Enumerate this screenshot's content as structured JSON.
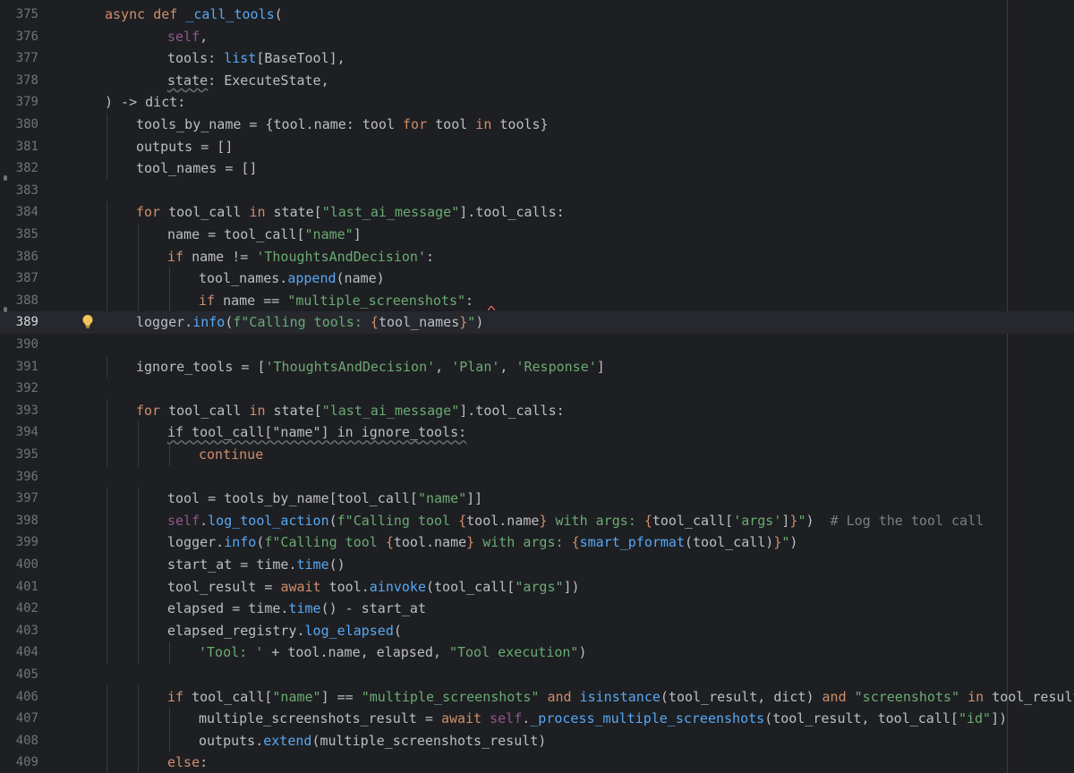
{
  "editor": {
    "current_line": 389,
    "lines": [
      {
        "n": 375,
        "indent": 0,
        "tokens": [
          [
            "async ",
            "kw"
          ],
          [
            "def ",
            "kw"
          ],
          [
            "_call_tools",
            "fn"
          ],
          [
            "(",
            ""
          ]
        ]
      },
      {
        "n": 376,
        "indent": 2,
        "tokens": [
          [
            "self",
            "self"
          ],
          [
            ",",
            ""
          ]
        ]
      },
      {
        "n": 377,
        "indent": 2,
        "tokens": [
          [
            "tools",
            ""
          ],
          [
            ": ",
            ""
          ],
          [
            "list",
            "m"
          ],
          [
            "[BaseTool],",
            ""
          ]
        ]
      },
      {
        "n": 378,
        "indent": 2,
        "tokens": [
          [
            "state",
            "sq"
          ],
          [
            ": ExecuteState,",
            ""
          ]
        ]
      },
      {
        "n": 379,
        "indent": 0,
        "tokens": [
          [
            ") -> ",
            ""
          ],
          [
            "dict",
            ""
          ],
          [
            ":",
            ""
          ]
        ]
      },
      {
        "n": 380,
        "indent": 1,
        "tokens": [
          [
            "tools_by_name = {tool.name: tool ",
            ""
          ],
          [
            "for ",
            "kw"
          ],
          [
            "tool ",
            ""
          ],
          [
            "in ",
            "kw"
          ],
          [
            "tools",
            ""
          ],
          [
            "}",
            ""
          ]
        ]
      },
      {
        "n": 381,
        "indent": 1,
        "tokens": [
          [
            "outputs = []",
            ""
          ]
        ]
      },
      {
        "n": 382,
        "indent": 1,
        "tokens": [
          [
            "tool_names = []",
            ""
          ]
        ]
      },
      {
        "n": 383,
        "indent": 0,
        "tokens": []
      },
      {
        "n": 384,
        "indent": 1,
        "tokens": [
          [
            "for ",
            "kw"
          ],
          [
            "tool_call ",
            ""
          ],
          [
            "in ",
            "kw"
          ],
          [
            "state[",
            ""
          ],
          [
            "\"last_ai_message\"",
            "str"
          ],
          [
            "].tool_calls:",
            ""
          ]
        ]
      },
      {
        "n": 385,
        "indent": 2,
        "tokens": [
          [
            "name = tool_call[",
            ""
          ],
          [
            "\"name\"",
            "str"
          ],
          [
            "]",
            ""
          ]
        ]
      },
      {
        "n": 386,
        "indent": 2,
        "tokens": [
          [
            "if ",
            "kw"
          ],
          [
            "name != ",
            ""
          ],
          [
            "'ThoughtsAndDecision'",
            "str"
          ],
          [
            ":",
            ""
          ]
        ]
      },
      {
        "n": 387,
        "indent": 3,
        "tokens": [
          [
            "tool_names.",
            ""
          ],
          [
            "append",
            "m"
          ],
          [
            "(name)",
            ""
          ]
        ]
      },
      {
        "n": 388,
        "indent": 3,
        "tokens": [
          [
            "if ",
            "kw"
          ],
          [
            "name == ",
            ""
          ],
          [
            "\"multiple_screenshots\"",
            "str"
          ],
          [
            ":",
            ""
          ]
        ]
      },
      {
        "n": 389,
        "indent": 1,
        "tokens": [
          [
            "logger.",
            ""
          ],
          [
            "info",
            "m"
          ],
          [
            "(",
            ""
          ],
          [
            "f\"Calling tools: ",
            "str"
          ],
          [
            "{",
            "br"
          ],
          [
            "tool_names",
            ""
          ],
          [
            "}",
            "br"
          ],
          [
            "\"",
            "str"
          ],
          [
            ")",
            ""
          ]
        ]
      },
      {
        "n": 390,
        "indent": 0,
        "tokens": []
      },
      {
        "n": 391,
        "indent": 1,
        "tokens": [
          [
            "ignore_tools = [",
            ""
          ],
          [
            "'ThoughtsAndDecision'",
            "str"
          ],
          [
            ", ",
            ""
          ],
          [
            "'Plan'",
            "str"
          ],
          [
            ", ",
            ""
          ],
          [
            "'Response'",
            "str"
          ],
          [
            "]",
            ""
          ]
        ]
      },
      {
        "n": 392,
        "indent": 0,
        "tokens": []
      },
      {
        "n": 393,
        "indent": 1,
        "tokens": [
          [
            "for ",
            "kw"
          ],
          [
            "tool_call ",
            ""
          ],
          [
            "in ",
            "kw"
          ],
          [
            "state[",
            ""
          ],
          [
            "\"last_ai_message\"",
            "str"
          ],
          [
            "].tool_calls:",
            ""
          ]
        ]
      },
      {
        "n": 394,
        "indent": 2,
        "tokens": [
          [
            "if tool_call[\"name\"] in ignore_tools:",
            "sq"
          ]
        ]
      },
      {
        "n": 395,
        "indent": 3,
        "tokens": [
          [
            "continue",
            "kw"
          ]
        ]
      },
      {
        "n": 396,
        "indent": 0,
        "tokens": []
      },
      {
        "n": 397,
        "indent": 2,
        "tokens": [
          [
            "tool = tools_by_name[tool_call[",
            ""
          ],
          [
            "\"name\"",
            "str"
          ],
          [
            "]]",
            ""
          ]
        ]
      },
      {
        "n": 398,
        "indent": 2,
        "tokens": [
          [
            "self",
            "self"
          ],
          [
            ".",
            ""
          ],
          [
            "log_tool_action",
            "m"
          ],
          [
            "(",
            ""
          ],
          [
            "f\"Calling tool ",
            "str"
          ],
          [
            "{",
            "br"
          ],
          [
            "tool.name",
            ""
          ],
          [
            "}",
            "br"
          ],
          [
            " with args: ",
            "str"
          ],
          [
            "{",
            "br"
          ],
          [
            "tool_call[",
            ""
          ],
          [
            "'args'",
            "str"
          ],
          [
            "]",
            ""
          ],
          [
            "}",
            "br"
          ],
          [
            "\"",
            "str"
          ],
          [
            ")  ",
            ""
          ],
          [
            "# Log the tool call",
            "cm"
          ]
        ]
      },
      {
        "n": 399,
        "indent": 2,
        "tokens": [
          [
            "logger.",
            ""
          ],
          [
            "info",
            "m"
          ],
          [
            "(",
            ""
          ],
          [
            "f\"Calling tool ",
            "str"
          ],
          [
            "{",
            "br"
          ],
          [
            "tool.name",
            ""
          ],
          [
            "}",
            "br"
          ],
          [
            " with args: ",
            "str"
          ],
          [
            "{",
            "br"
          ],
          [
            "smart_pformat",
            "m"
          ],
          [
            "(tool_call)",
            ""
          ],
          [
            "}",
            "br"
          ],
          [
            "\"",
            "str"
          ],
          [
            ")",
            ""
          ]
        ]
      },
      {
        "n": 400,
        "indent": 2,
        "tokens": [
          [
            "start_at = time.",
            ""
          ],
          [
            "time",
            "m"
          ],
          [
            "()",
            ""
          ]
        ]
      },
      {
        "n": 401,
        "indent": 2,
        "tokens": [
          [
            "tool_result = ",
            ""
          ],
          [
            "await ",
            "kw"
          ],
          [
            "tool.",
            ""
          ],
          [
            "ainvoke",
            "m"
          ],
          [
            "(tool_call[",
            ""
          ],
          [
            "\"args\"",
            "str"
          ],
          [
            "])",
            ""
          ]
        ]
      },
      {
        "n": 402,
        "indent": 2,
        "tokens": [
          [
            "elapsed = time.",
            ""
          ],
          [
            "time",
            "m"
          ],
          [
            "() - start_at",
            ""
          ]
        ]
      },
      {
        "n": 403,
        "indent": 2,
        "tokens": [
          [
            "elapsed_registry.",
            ""
          ],
          [
            "log_elapsed",
            "m"
          ],
          [
            "(",
            ""
          ]
        ]
      },
      {
        "n": 404,
        "indent": 3,
        "tokens": [
          [
            "'Tool: '",
            "str"
          ],
          [
            " + tool.name, elapsed, ",
            ""
          ],
          [
            "\"Tool execution\"",
            "str"
          ],
          [
            ")",
            ""
          ]
        ]
      },
      {
        "n": 405,
        "indent": 0,
        "tokens": []
      },
      {
        "n": 406,
        "indent": 2,
        "tokens": [
          [
            "if ",
            "kw"
          ],
          [
            "tool_call[",
            ""
          ],
          [
            "\"name\"",
            "str"
          ],
          [
            "] == ",
            ""
          ],
          [
            "\"multiple_screenshots\"",
            "str"
          ],
          [
            " ",
            ""
          ],
          [
            "and ",
            "kw"
          ],
          [
            "isinstance",
            "m"
          ],
          [
            "(tool_result, ",
            ""
          ],
          [
            "dict",
            ""
          ],
          [
            ") ",
            ""
          ],
          [
            "and ",
            "kw"
          ],
          [
            "\"screenshots\"",
            "str"
          ],
          [
            " ",
            ""
          ],
          [
            "in ",
            "kw"
          ],
          [
            "tool_result:",
            ""
          ]
        ]
      },
      {
        "n": 407,
        "indent": 3,
        "tokens": [
          [
            "multiple_screenshots_result = ",
            ""
          ],
          [
            "await ",
            "kw"
          ],
          [
            "self",
            "self"
          ],
          [
            ".",
            ""
          ],
          [
            "_process_multiple_screenshots",
            "m"
          ],
          [
            "(tool_result, tool_call[",
            ""
          ],
          [
            "\"id\"",
            "str"
          ],
          [
            "])",
            ""
          ]
        ]
      },
      {
        "n": 408,
        "indent": 3,
        "tokens": [
          [
            "outputs.",
            ""
          ],
          [
            "extend",
            "m"
          ],
          [
            "(multiple_screenshots_result)",
            ""
          ]
        ]
      },
      {
        "n": 409,
        "indent": 2,
        "tokens": [
          [
            "else",
            "kw"
          ],
          [
            ":",
            ""
          ]
        ]
      }
    ],
    "guides": {
      "380": [
        1
      ],
      "381": [
        1
      ],
      "382": [
        1
      ],
      "384": [
        1
      ],
      "385": [
        1,
        2
      ],
      "386": [
        1,
        2
      ],
      "387": [
        1,
        2,
        3
      ],
      "388": [
        1,
        2,
        3
      ],
      "391": [
        1
      ],
      "393": [
        1
      ],
      "394": [
        1,
        2
      ],
      "395": [
        1,
        2,
        3
      ],
      "397": [
        1,
        2
      ],
      "398": [
        1,
        2
      ],
      "399": [
        1,
        2
      ],
      "400": [
        1,
        2
      ],
      "401": [
        1,
        2
      ],
      "402": [
        1,
        2
      ],
      "403": [
        1,
        2
      ],
      "404": [
        1,
        2,
        3
      ],
      "406": [
        1,
        2
      ],
      "407": [
        1,
        2,
        3
      ],
      "408": [
        1,
        2,
        3
      ],
      "409": [
        1,
        2
      ]
    },
    "gutter_markers": [
      383,
      389
    ],
    "icons": {
      "bulb": "lightbulb-icon"
    }
  }
}
